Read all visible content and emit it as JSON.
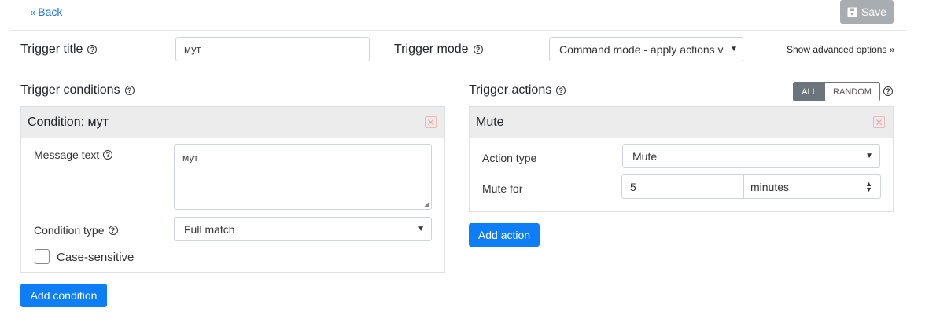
{
  "top": {
    "back_label": "Back",
    "save_label": "Save"
  },
  "trigger": {
    "title_label": "Trigger title",
    "title_value": "мут",
    "mode_label": "Trigger mode",
    "mode_value": "Command mode - apply actions v",
    "advanced_link": "Show advanced options »"
  },
  "conditions": {
    "heading": "Trigger conditions",
    "card_title": "Condition: мут",
    "message_text_label": "Message text",
    "message_text_value": "мут",
    "condition_type_label": "Condition type",
    "condition_type_value": "Full match",
    "case_sensitive_label": "Case-sensitive",
    "add_button": "Add condition"
  },
  "actions": {
    "heading": "Trigger actions",
    "toggle_all": "ALL",
    "toggle_random": "RANDOM",
    "card_title": "Mute",
    "action_type_label": "Action type",
    "action_type_value": "Mute",
    "mute_for_label": "Mute for",
    "mute_for_value": "5",
    "mute_unit_value": "minutes",
    "add_button": "Add action"
  }
}
